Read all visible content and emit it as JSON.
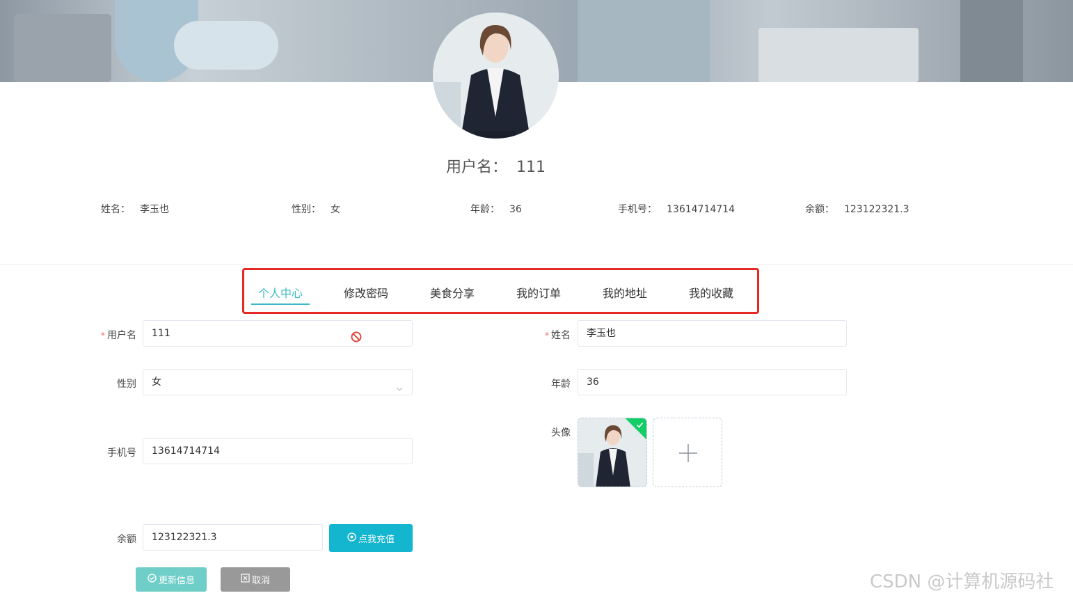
{
  "header": {
    "username_label": "用户名：",
    "username_value": "111"
  },
  "info": [
    {
      "label": "姓名：",
      "value": "李玉也"
    },
    {
      "label": "性别：",
      "value": "女"
    },
    {
      "label": "年龄：",
      "value": "36"
    },
    {
      "label": "手机号：",
      "value": "13614714714"
    },
    {
      "label": "余额：",
      "value": "123122321.3"
    }
  ],
  "tabs": [
    {
      "label": "个人中心",
      "active": true
    },
    {
      "label": "修改密码"
    },
    {
      "label": "美食分享"
    },
    {
      "label": "我的订单"
    },
    {
      "label": "我的地址"
    },
    {
      "label": "我的收藏"
    }
  ],
  "form": {
    "username": {
      "label": "用户名",
      "value": "111"
    },
    "name": {
      "label": "姓名",
      "value": "李玉也"
    },
    "gender": {
      "label": "性别",
      "value": "女"
    },
    "age": {
      "label": "年龄",
      "value": "36"
    },
    "avatar": {
      "label": "头像"
    },
    "phone": {
      "label": "手机号",
      "value": "13614714714"
    },
    "balance": {
      "label": "余额",
      "value": "123122321.3"
    }
  },
  "buttons": {
    "recharge": "点我充值",
    "update": "更新信息",
    "cancel": "取消"
  },
  "colors": {
    "accent": "#3dbac3",
    "recharge_button": "#13b5cf",
    "update_button": "#6fcfc8",
    "cancel_button": "#999999",
    "highlight_border": "#e52a25"
  },
  "watermark": "CSDN @计算机源码社"
}
